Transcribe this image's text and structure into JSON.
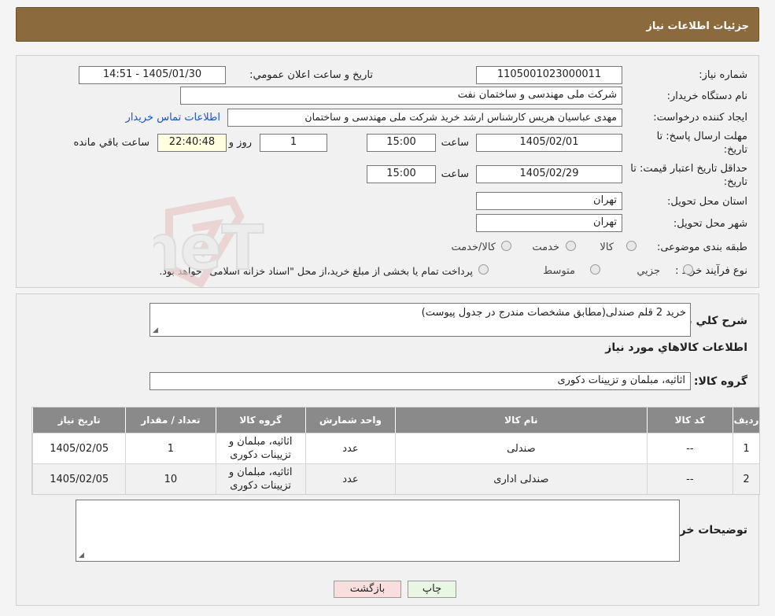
{
  "header": {
    "title": "جزئیات اطلاعات نیاز"
  },
  "fields": {
    "need_number_label": "شماره نیاز:",
    "need_number": "1105001023000011",
    "announce_label": "تاریخ و ساعت اعلان عمومي:",
    "announce_value": "1405/01/30 - 14:51",
    "buyer_org_label": "نام دستگاه خریدار:",
    "buyer_org": "شرکت ملی مهندسی و ساختمان نفت",
    "creator_label": "ایجاد کننده درخواست:",
    "creator": "مهدی عباسیان هریس کارشناس ارشد خرید شرکت ملی مهندسی و ساختمان",
    "contact_link": "اطلاعات تماس خریدار",
    "reply_deadline_label_1": "مهلت ارسال پاسخ: تا",
    "reply_deadline_label_2": "تاریخ:",
    "reply_date": "1405/02/01",
    "time_label": "ساعت",
    "reply_time": "15:00",
    "days_value": "1",
    "days_label": "روز و",
    "remaining_time": "22:40:48",
    "remaining_label": "ساعت باقي مانده",
    "price_validity_label_1": "حداقل تاریخ اعتبار قیمت: تا",
    "price_validity_label_2": "تاریخ:",
    "price_date": "1405/02/29",
    "price_time": "15:00",
    "province_label": "استان محل تحویل:",
    "province": "تهران",
    "city_label": "شهر محل تحویل:",
    "city": "تهران",
    "category_label": "طبقه بندی موضوعی:",
    "category_options": [
      "کالا",
      "خدمت",
      "کالا/خدمت"
    ],
    "process_label": "نوع فرآیند خرید :",
    "process_options": [
      "جزيي",
      "متوسط"
    ],
    "process_note": "پرداخت تمام یا بخشی از مبلغ خرید،از محل \"اسناد خزانه اسلامی\" خواهد بود."
  },
  "summary": {
    "label": "شرح کلي نیاز:",
    "text": "خرید 2 قلم صندلی(مطابق مشخصات مندرج در جدول پیوست)"
  },
  "goods": {
    "section_title": "اطلاعات کالاهاي مورد نیاز",
    "group_label": "گروه کالا:",
    "group_value": "اثاثیه، مبلمان و تزیینات دکوری",
    "columns": [
      "رديف",
      "کد کالا",
      "نام کالا",
      "واحد شمارش",
      "گروه کالا",
      "تعداد / مقدار",
      "تاریخ نیاز"
    ],
    "rows": [
      {
        "row": "1",
        "code": "--",
        "name": "صندلی",
        "unit": "عدد",
        "group_line1": "اثاثیه، مبلمان و",
        "group_line2": "تزیینات دکوری",
        "qty": "1",
        "date": "1405/02/05"
      },
      {
        "row": "2",
        "code": "--",
        "name": "صندلی اداری",
        "unit": "عدد",
        "group_line1": "اثاثیه، مبلمان و",
        "group_line2": "تزیینات دکوری",
        "qty": "10",
        "date": "1405/02/05"
      }
    ]
  },
  "buyer_notes": {
    "label": "توضیحات خریدار:",
    "value": ""
  },
  "buttons": {
    "print": "چاپ",
    "back": "بازگشت"
  },
  "watermark": {
    "text": "AriaTender.neT"
  },
  "colors": {
    "header": "#8b6b3d",
    "table_header": "#8a8a8a",
    "link": "#1a4fd6"
  }
}
